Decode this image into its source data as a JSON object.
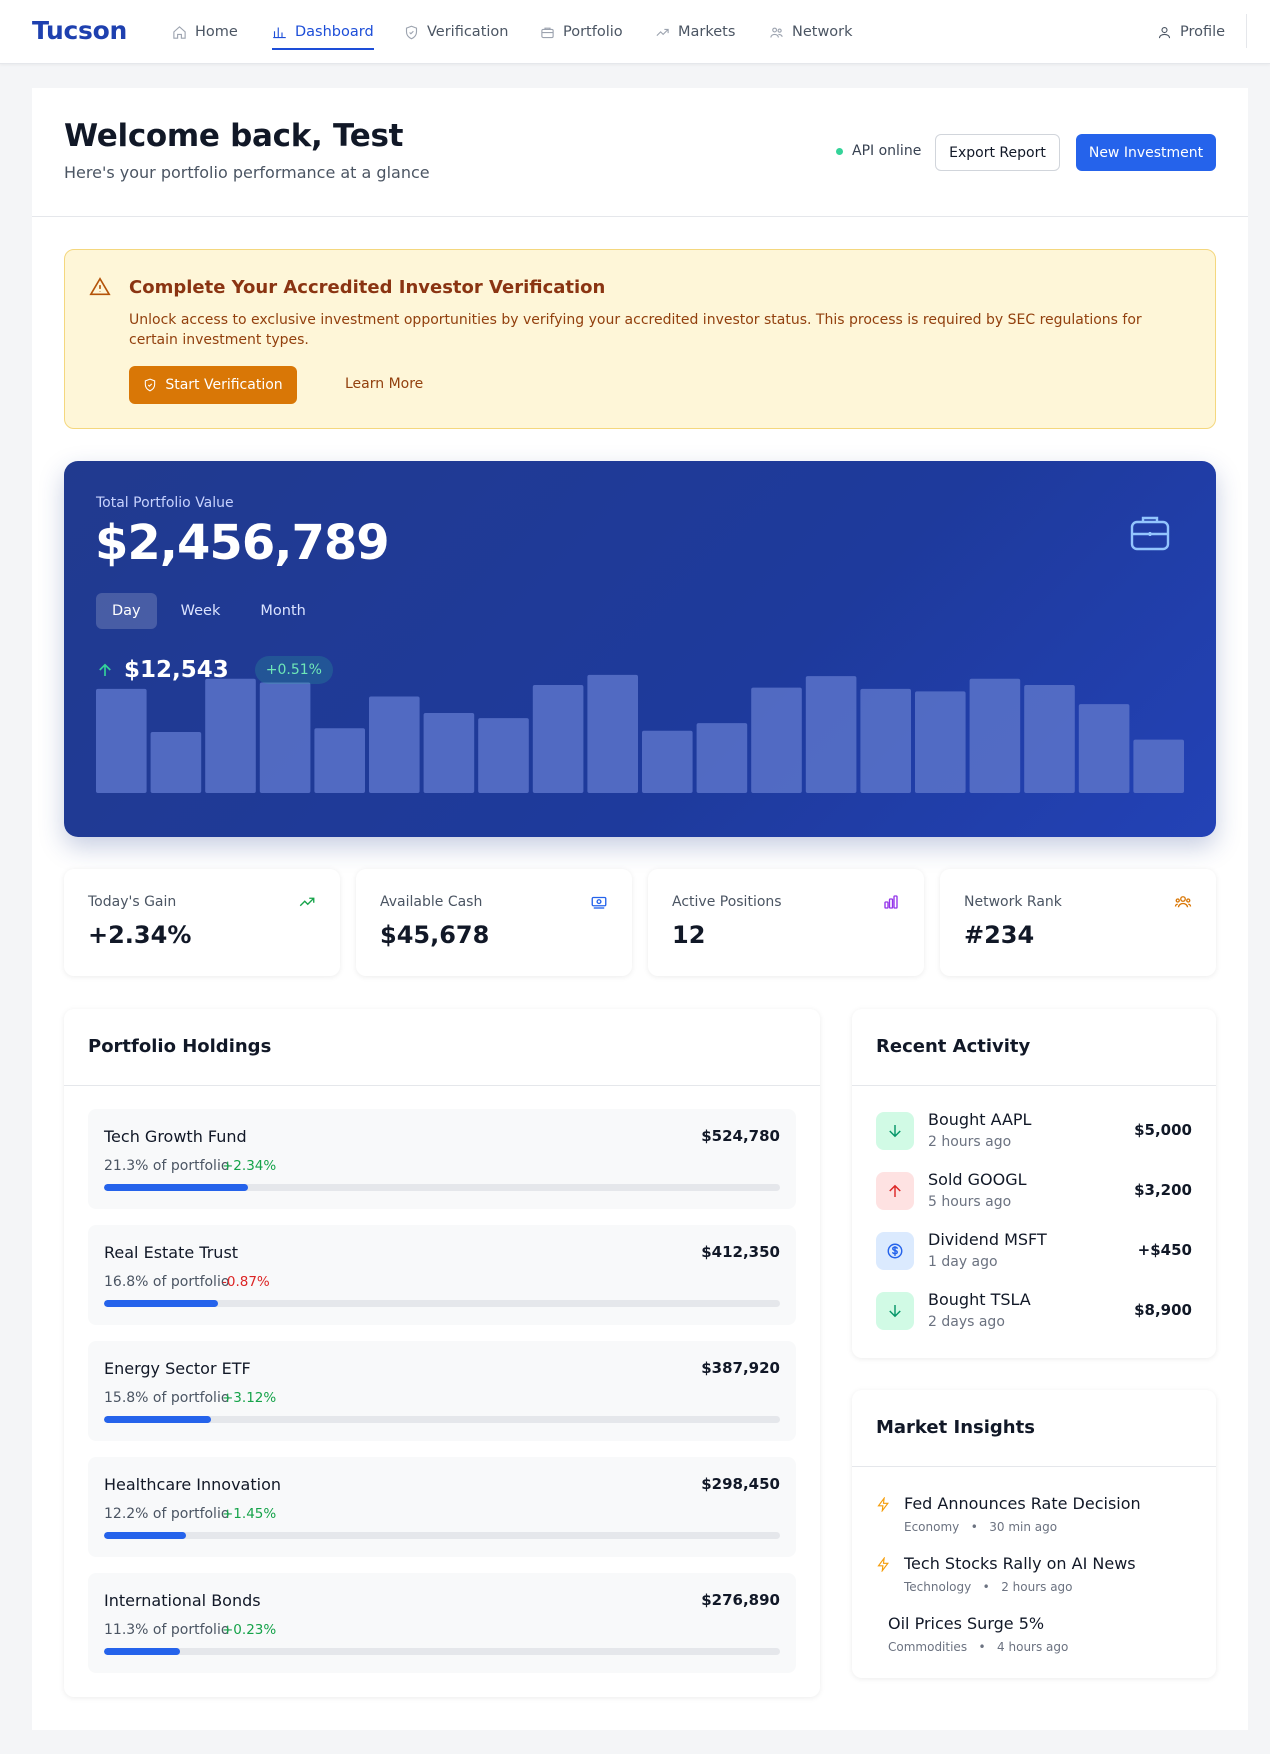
{
  "nav": {
    "brand": "Tucson",
    "items": [
      {
        "label": "Home",
        "icon": "home-icon"
      },
      {
        "label": "Dashboard",
        "icon": "bar-chart-icon",
        "active": true
      },
      {
        "label": "Verification",
        "icon": "shield-icon"
      },
      {
        "label": "Portfolio",
        "icon": "briefcase-icon"
      },
      {
        "label": "Markets",
        "icon": "trending-up-icon"
      },
      {
        "label": "Network",
        "icon": "users-icon"
      }
    ],
    "profile": "Profile"
  },
  "header": {
    "welcome": "Welcome back, Test",
    "subtitle": "Here's your portfolio performance at a glance",
    "api_status": "API online",
    "export_label": "Export Report",
    "new_investment_label": "New Investment"
  },
  "alert": {
    "title": "Complete Your Accredited Investor Verification",
    "text": "Unlock access to exclusive investment opportunities by verifying your accredited investor status. This process is required by SEC regulations for certain investment types.",
    "primary_label": "Start Verification",
    "secondary_label": "Learn More"
  },
  "portfolio": {
    "label": "Total Portfolio Value",
    "value": "$2,456,789",
    "tabs": [
      "Day",
      "Week",
      "Month"
    ],
    "active_tab": "Day",
    "change_value": "$12,543",
    "change_percent": "+0.51%",
    "colors": {
      "bar": "#5b73c9",
      "positive": "#34d399"
    }
  },
  "chart_data": {
    "type": "bar",
    "categories": [],
    "values": [
      82,
      48,
      90,
      87,
      51,
      76,
      63,
      59,
      85,
      93,
      49,
      55,
      83,
      92,
      82,
      80,
      90,
      85,
      70,
      42
    ],
    "title": "",
    "xlabel": "",
    "ylabel": "",
    "ylim": [
      0,
      100
    ],
    "grid": false
  },
  "stats": [
    {
      "label": "Today's Gain",
      "value": "+2.34%",
      "icon": "trending-up-icon",
      "color": "#16a34a"
    },
    {
      "label": "Available Cash",
      "value": "$45,678",
      "icon": "cash-icon",
      "color": "#2563eb"
    },
    {
      "label": "Active Positions",
      "value": "12",
      "icon": "bar-chart-icon",
      "color": "#9333ea"
    },
    {
      "label": "Network Rank",
      "value": "#234",
      "icon": "users-icon",
      "color": "#d97706"
    }
  ],
  "holdings": {
    "title": "Portfolio Holdings",
    "items": [
      {
        "name": "Tech Growth Fund",
        "value": "$524,780",
        "share": "21.3% of portfolio",
        "change": "+2.34%",
        "direction": "up",
        "share_pct": 21.3
      },
      {
        "name": "Real Estate Trust",
        "value": "$412,350",
        "share": "16.8% of portfolio",
        "change": "-0.87%",
        "direction": "down",
        "share_pct": 16.8
      },
      {
        "name": "Energy Sector ETF",
        "value": "$387,920",
        "share": "15.8% of portfolio",
        "change": "+3.12%",
        "direction": "up",
        "share_pct": 15.8
      },
      {
        "name": "Healthcare Innovation",
        "value": "$298,450",
        "share": "12.2% of portfolio",
        "change": "+1.45%",
        "direction": "up",
        "share_pct": 12.2
      },
      {
        "name": "International Bonds",
        "value": "$276,890",
        "share": "11.3% of portfolio",
        "change": "+0.23%",
        "direction": "up",
        "share_pct": 11.3
      }
    ]
  },
  "activity": {
    "title": "Recent Activity",
    "items": [
      {
        "title": "Bought AAPL",
        "time": "2 hours ago",
        "amount": "$5,000",
        "icon": "arrow-down-icon",
        "type": "buy"
      },
      {
        "title": "Sold GOOGL",
        "time": "5 hours ago",
        "amount": "$3,200",
        "icon": "arrow-up-icon",
        "type": "sell"
      },
      {
        "title": "Dividend MSFT",
        "time": "1 day ago",
        "amount": "+$450",
        "icon": "dollar-icon",
        "type": "dividend"
      },
      {
        "title": "Bought TSLA",
        "time": "2 days ago",
        "amount": "$8,900",
        "icon": "arrow-down-icon",
        "type": "buy"
      }
    ]
  },
  "insights": {
    "title": "Market Insights",
    "items": [
      {
        "title": "Fed Announces Rate Decision",
        "category": "Economy",
        "time": "30 min ago",
        "icon": "lightning-icon"
      },
      {
        "title": "Tech Stocks Rally on AI News",
        "category": "Technology",
        "time": "2 hours ago",
        "icon": "lightning-icon"
      },
      {
        "title": "Oil Prices Surge 5%",
        "category": "Commodities",
        "time": "4 hours ago",
        "icon": ""
      }
    ]
  }
}
